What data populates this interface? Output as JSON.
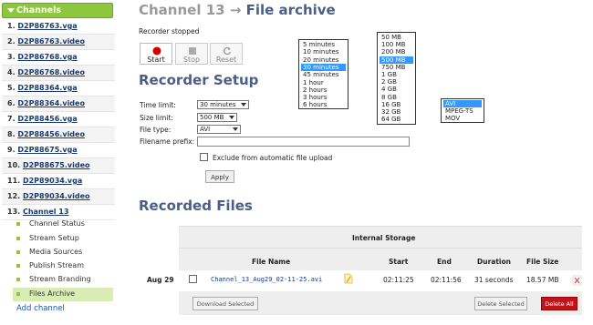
{
  "sidebar": {
    "header": "Channels",
    "items": [
      {
        "num": "1.",
        "name": "D2P86763.vga"
      },
      {
        "num": "2.",
        "name": "D2P86763.video"
      },
      {
        "num": "3.",
        "name": "D2P86768.vga"
      },
      {
        "num": "4.",
        "name": "D2P86768.video"
      },
      {
        "num": "5.",
        "name": "D2P88364.vga"
      },
      {
        "num": "6.",
        "name": "D2P88364.video"
      },
      {
        "num": "7.",
        "name": "D2P88456.vga"
      },
      {
        "num": "8.",
        "name": "D2P88456.video"
      },
      {
        "num": "9.",
        "name": "D2P88675.vga"
      },
      {
        "num": "10.",
        "name": "D2P88675.video"
      },
      {
        "num": "11.",
        "name": "D2P89034.vga"
      },
      {
        "num": "12.",
        "name": "D2P89034.video"
      },
      {
        "num": "13.",
        "name": "Channel 13"
      }
    ],
    "subitems": [
      "Channel Status",
      "Stream Setup",
      "Media Sources",
      "Publish Stream",
      "Stream Branding",
      "Files Archive"
    ],
    "add_channel": "Add channel"
  },
  "header": {
    "channel": "Channel 13",
    "arrow": "→",
    "page": "File archive"
  },
  "recorder": {
    "status": "Recorder stopped",
    "start": "Start",
    "stop": "Stop",
    "reset": "Reset"
  },
  "setup": {
    "title": "Recorder Setup",
    "time_limit_label": "Time limit:",
    "time_limit_value": "30 minutes",
    "size_limit_label": "Size limit:",
    "size_limit_value": "500 MB",
    "file_type_label": "File type:",
    "file_type_value": "AVI",
    "filename_prefix_label": "Filename prefix:",
    "exclude_label": "Exclude from automatic file upload",
    "apply": "Apply",
    "time_options": [
      "5 minutes",
      "10 minutes",
      "20 minutes",
      "30 minutes",
      "45 minutes",
      "1 hour",
      "2 hours",
      "3 hours",
      "6 hours"
    ],
    "size_options": [
      "50 MB",
      "100 MB",
      "200 MB",
      "500 MB",
      "750 MB",
      "1 GB",
      "2 GB",
      "4 GB",
      "8 GB",
      "16 GB",
      "32 GB",
      "64 GB"
    ],
    "type_options": [
      "AVI",
      "MPEG-TS",
      "MOV"
    ]
  },
  "files": {
    "title": "Recorded Files",
    "storage": "Internal Storage",
    "columns": {
      "name": "File Name",
      "start": "Start",
      "end": "End",
      "duration": "Duration",
      "size": "File Size"
    },
    "rows": [
      {
        "date": "Aug 29",
        "name": "Channel_13_Aug29_02-11-25.avi",
        "start": "02:11:25",
        "end": "02:11:56",
        "duration": "31 seconds",
        "size": "18.57 MB"
      }
    ],
    "download_selected": "Download Selected",
    "delete_selected": "Delete Selected",
    "delete_all": "Delete All"
  },
  "colors": {
    "accent": "#8dc63f",
    "title": "#4a5f88",
    "danger": "#c0141c"
  }
}
